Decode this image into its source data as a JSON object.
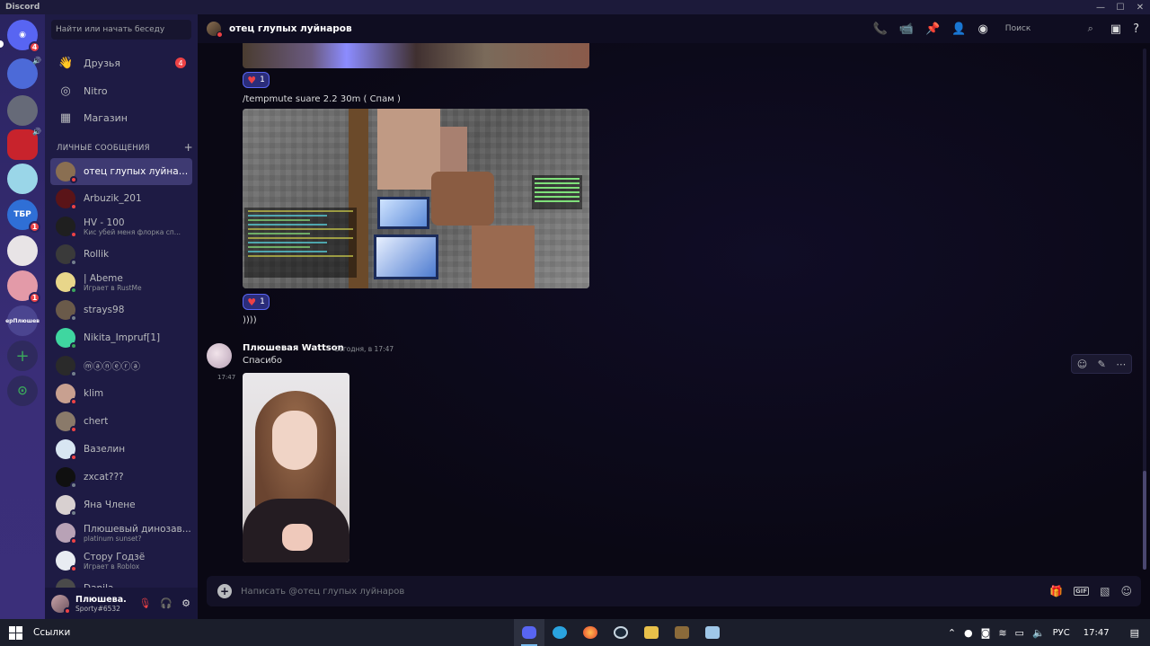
{
  "window": {
    "title": "Discord",
    "controls": [
      "—",
      "☐",
      "✕"
    ]
  },
  "servers": [
    {
      "name": "home",
      "label": "",
      "badge": "4",
      "color": "#5865f2"
    },
    {
      "name": "server-2",
      "label": "",
      "badge": "",
      "color": "#4c6ad8"
    },
    {
      "name": "server-3",
      "label": "",
      "badge": "",
      "color": "#666a78"
    },
    {
      "name": "server-4",
      "label": "",
      "badge": "",
      "color": "#c8232c"
    },
    {
      "name": "server-5",
      "label": "",
      "badge": "",
      "color": "#9ad6e8"
    },
    {
      "name": "server-6",
      "label": "ТБР",
      "badge": "1",
      "color": "#2f6fd6"
    },
    {
      "name": "server-7",
      "label": "",
      "badge": "",
      "color": "#e8e4e6"
    },
    {
      "name": "server-8",
      "label": "",
      "badge": "1",
      "color": "#e39aa8"
    },
    {
      "name": "server-9",
      "label": "ерПлюшев",
      "badge": "",
      "color": "#4b4590"
    }
  ],
  "rail_actions": {
    "add": "+",
    "explore": "⊙"
  },
  "sidebar": {
    "search_placeholder": "Найти или начать беседу",
    "nav": [
      {
        "label": "Друзья",
        "icon": "👋",
        "badge": "4"
      },
      {
        "label": "Nitro",
        "icon": "◎",
        "badge": ""
      },
      {
        "label": "Магазин",
        "icon": "▦",
        "badge": ""
      }
    ],
    "dm_header": "ЛИЧНЫЕ СООБЩЕНИЯ",
    "dm_add": "+",
    "dms": [
      {
        "name": "отец глупых луйнаров",
        "sub": "",
        "status": "#ed4245",
        "av": "#8a6f52",
        "active": true
      },
      {
        "name": "Arbuzik_201",
        "sub": "",
        "status": "#ed4245",
        "av": "#5a1418"
      },
      {
        "name": "HV - 100",
        "sub": "Кис убей меня флорка сп...",
        "status": "#ed4245",
        "av": "#1f1f1f"
      },
      {
        "name": "Rollik",
        "sub": "",
        "status": "#747f8d",
        "av": "#3a3a3a"
      },
      {
        "name": "| Abeme",
        "sub": "Играет в RustMe",
        "status": "#3ba55c",
        "av": "#e8d68a"
      },
      {
        "name": "strays98",
        "sub": "",
        "status": "#747f8d",
        "av": "#6a5a4a"
      },
      {
        "name": "Nikita_Impruf[1]",
        "sub": "",
        "status": "#3ba55c",
        "av": "#3fd6a0"
      },
      {
        "name": "ⓜⓐⓝⓔⓡⓐ",
        "sub": "",
        "status": "#747f8d",
        "av": "#2a2a2a"
      },
      {
        "name": "klim",
        "sub": "",
        "status": "#ed4245",
        "av": "#c8a090"
      },
      {
        "name": "chert",
        "sub": "",
        "status": "#ed4245",
        "av": "#8a7a6a"
      },
      {
        "name": "Вазелин",
        "sub": "",
        "status": "#ed4245",
        "av": "#d8e6f2"
      },
      {
        "name": "zxcat???",
        "sub": "",
        "status": "#747f8d",
        "av": "#101010"
      },
      {
        "name": "Яна Члене",
        "sub": "",
        "status": "#747f8d",
        "av": "#d8d0d0"
      },
      {
        "name": "Плюшевый динозав...",
        "sub": "platinum sunset?",
        "status": "#ed4245",
        "av": "#b8a2b6"
      },
      {
        "name": "Стору Годзё",
        "sub": "Играет в Roblox",
        "status": "#ed4245",
        "av": "#e8ecf2"
      },
      {
        "name": "Danila",
        "sub": "",
        "status": "#747f8d",
        "av": "#4a4a4a"
      }
    ]
  },
  "user": {
    "name": "Плюшева...",
    "tag": "Sporty#6532",
    "mic_icon": "🎙",
    "headset_icon": "🎧",
    "settings_icon": "⚙"
  },
  "header": {
    "title": "отец глупых луйнаров",
    "search_placeholder": "Поиск"
  },
  "messages": {
    "reaction_count_1": "1",
    "command_text": "/tempmute suare 2.2 30m ( Спам )",
    "reaction_count_2": "1",
    "short_text": "))))",
    "group": {
      "author": "Плюшевая Wattson",
      "time": "Сегодня, в 17:47",
      "text": "Спасибо",
      "hover_time": "17:47"
    }
  },
  "composer": {
    "placeholder": "Написать @отец глупых луйнаров",
    "gif_label": "GIF"
  },
  "taskbar": {
    "links": "Ссылки",
    "lang": "РУС",
    "time": "17:47"
  }
}
